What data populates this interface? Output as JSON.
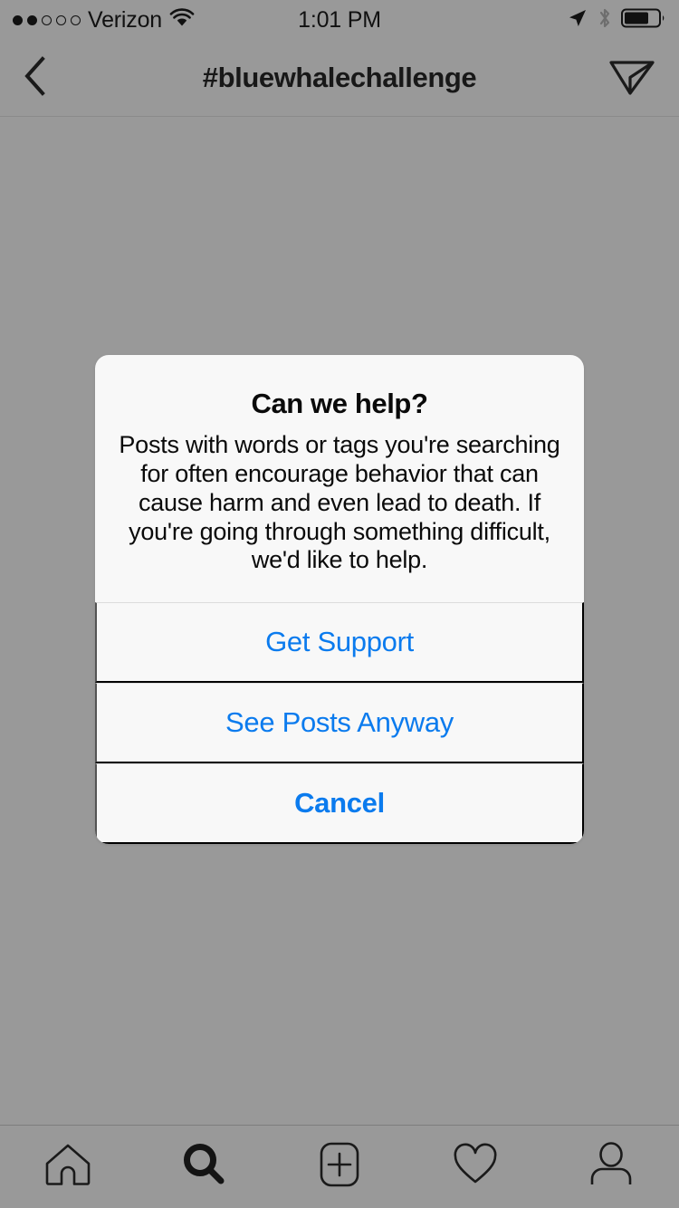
{
  "status_bar": {
    "signal_dots_filled": 2,
    "signal_dots_total": 5,
    "carrier": "Verizon",
    "wifi_icon": "wifi-icon",
    "time": "1:01 PM",
    "location_icon": "location-arrow-icon",
    "bluetooth_icon": "bluetooth-icon",
    "battery_icon": "battery-icon",
    "battery_level_percent": 65
  },
  "nav_bar": {
    "back_icon": "chevron-left-icon",
    "title": "#bluewhalechallenge",
    "direct_icon": "paper-plane-icon"
  },
  "alert": {
    "title": "Can we help?",
    "message": "Posts with words or tags you're searching for often encourage behavior that can cause harm and even lead to death. If you're going through something difficult, we'd like to help.",
    "buttons": [
      {
        "label": "Get Support",
        "style": "regular"
      },
      {
        "label": "See Posts Anyway",
        "style": "regular"
      },
      {
        "label": "Cancel",
        "style": "bold"
      }
    ],
    "accent_color": "#0b7bee",
    "background_color": "#f8f8f8"
  },
  "tab_bar": {
    "tabs": [
      {
        "name": "home",
        "icon": "home-icon",
        "active": false
      },
      {
        "name": "search",
        "icon": "search-icon",
        "active": true
      },
      {
        "name": "add-post",
        "icon": "plus-square-icon",
        "active": false
      },
      {
        "name": "activity",
        "icon": "heart-icon",
        "active": false
      },
      {
        "name": "profile",
        "icon": "person-icon",
        "active": false
      }
    ]
  },
  "theme": {
    "backdrop_color": "#999999",
    "icon_color": "#1a1a1a"
  }
}
